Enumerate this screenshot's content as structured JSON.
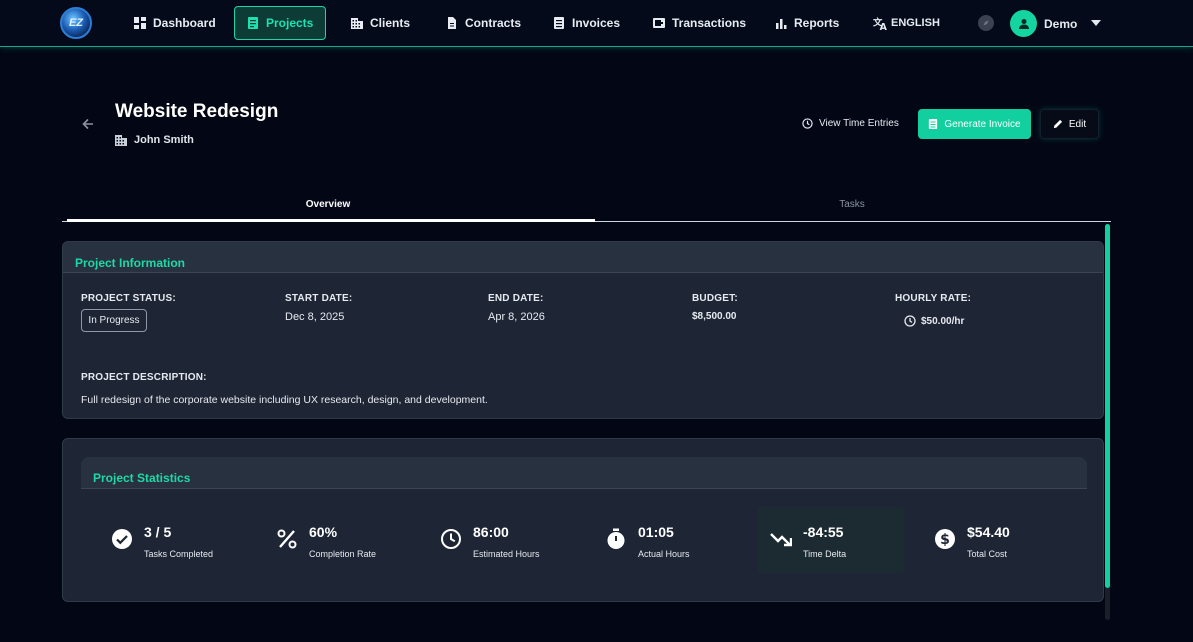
{
  "nav": {
    "logo_text": "EZ",
    "items": [
      {
        "label": "Dashboard",
        "icon": "dashboard-icon"
      },
      {
        "label": "Projects",
        "icon": "projects-icon",
        "active": true
      },
      {
        "label": "Clients",
        "icon": "building-icon"
      },
      {
        "label": "Contracts",
        "icon": "document-icon"
      },
      {
        "label": "Invoices",
        "icon": "invoice-icon"
      },
      {
        "label": "Transactions",
        "icon": "wallet-icon"
      },
      {
        "label": "Reports",
        "icon": "bar-chart-icon"
      }
    ],
    "language": "ENGLISH",
    "user": "Demo"
  },
  "header": {
    "title": "Website Redesign",
    "client": "John Smith",
    "view_time_entries": "View Time Entries",
    "generate_invoice": "Generate Invoice",
    "edit": "Edit"
  },
  "tabs": [
    {
      "label": "Overview",
      "active": true
    },
    {
      "label": "Tasks",
      "active": false
    }
  ],
  "project_info": {
    "title": "Project Information",
    "status_label": "PROJECT STATUS:",
    "status_value": "In Progress",
    "start_label": "START DATE:",
    "start_value": "Dec 8, 2025",
    "end_label": "END DATE:",
    "end_value": "Apr 8, 2026",
    "budget_label": "BUDGET:",
    "budget_value": "$8,500.00",
    "rate_label": "HOURLY RATE:",
    "rate_value": "$50.00/hr",
    "description_label": "PROJECT DESCRIPTION:",
    "description_value": "Full redesign of the corporate website including UX research, design, and development."
  },
  "stats": {
    "title": "Project Statistics",
    "items": [
      {
        "value": "3 / 5",
        "label": "Tasks Completed",
        "icon": "check-circle-icon"
      },
      {
        "value": "60%",
        "label": "Completion Rate",
        "icon": "percent-icon"
      },
      {
        "value": "86:00",
        "label": "Estimated Hours",
        "icon": "clock-icon"
      },
      {
        "value": "01:05",
        "label": "Actual Hours",
        "icon": "stopwatch-icon"
      },
      {
        "value": "-84:55",
        "label": "Time Delta",
        "icon": "trending-down-icon"
      },
      {
        "value": "$54.40",
        "label": "Total Cost",
        "icon": "dollar-circle-icon"
      }
    ]
  },
  "colors": {
    "accent": "#12cf9f",
    "background": "#030715",
    "card": "#1e2635"
  }
}
